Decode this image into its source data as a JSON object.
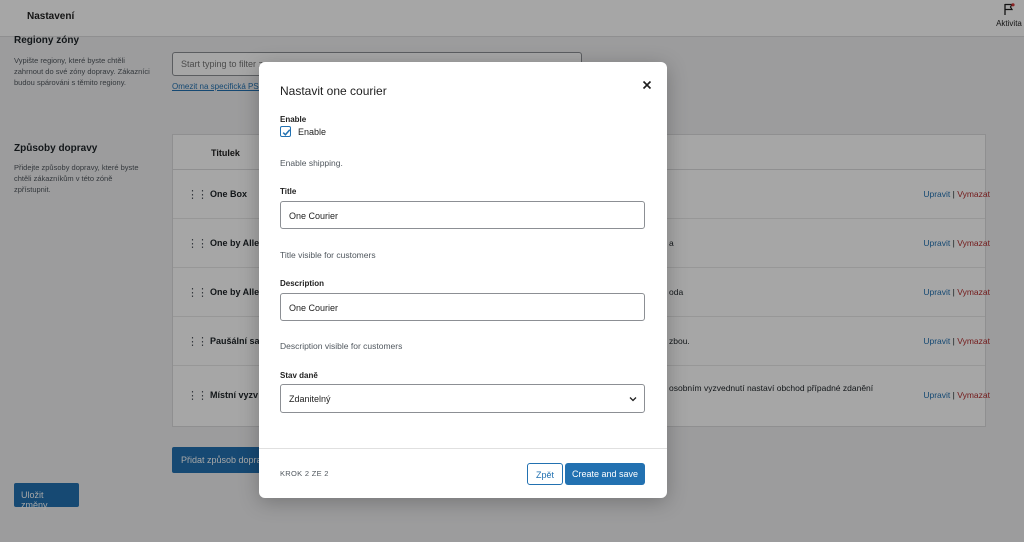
{
  "topbar": {
    "title": "Nastavení",
    "activity_label": "Aktivita"
  },
  "regions": {
    "title": "Regiony zóny",
    "description": "Vypište regiony, které byste chtěli zahrnout do své zóny dopravy. Zákazníci budou spárováni s těmito regiony.",
    "input_placeholder": "Start typing to filter zones",
    "limit_link": "Omezit na specifická PSČ"
  },
  "methods": {
    "title": "Způsoby dopravy",
    "description": "Přidejte způsoby dopravy, které byste chtěli zákazníkům v této zóně zpřístupnit.",
    "column_title": "Titulek",
    "rows": [
      {
        "name": "One Box",
        "desc": ""
      },
      {
        "name": "One by Alle",
        "desc": "a"
      },
      {
        "name": "One by Alle",
        "desc": "oda"
      },
      {
        "name": "Paušální sa",
        "desc": "zbou."
      },
      {
        "name": "Místní vyzv",
        "desc": "osobním vyzvednutí nastaví obchod případné zdanění"
      }
    ],
    "edit_label": "Upravit",
    "separator": "|",
    "delete_label": "Vymazat",
    "add_button": "Přidat způsob dopravy"
  },
  "save_button": "Uložit změny",
  "modal": {
    "title": "Nastavit one courier",
    "enable_label": "Enable",
    "enable_checkbox_label": "Enable",
    "enable_checked": true,
    "enable_help": "Enable shipping.",
    "title_label": "Title",
    "title_value": "One Courier",
    "title_help": "Title visible for customers",
    "description_label": "Description",
    "description_value": "One Courier",
    "description_help": "Description visible for customers",
    "tax_label": "Stav daně",
    "tax_value": "Zdanitelný",
    "step_text": "KROK 2 ZE 2",
    "back_button": "Zpět",
    "create_button": "Create and save"
  },
  "colors": {
    "accent": "#2271b1",
    "danger": "#b32d2e",
    "overlay": "rgba(0,0,0,0.35)"
  }
}
